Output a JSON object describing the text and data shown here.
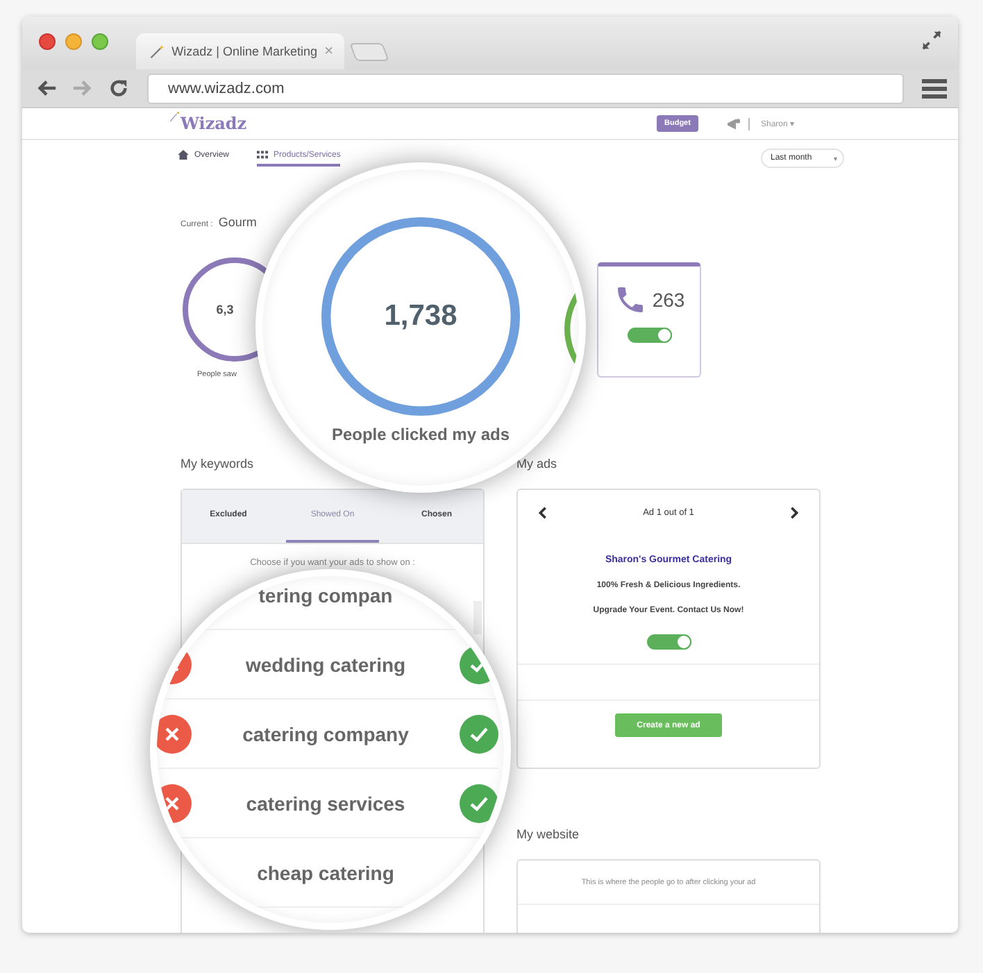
{
  "browser": {
    "tab_title": "Wizadz | Online Marketing",
    "tab_close": "×",
    "url": "www.wizadz.com"
  },
  "header": {
    "logo": "Wizadz",
    "budget_button": "Budget",
    "user": "Sharon",
    "user_caret": "▾"
  },
  "nav": {
    "tabs": [
      {
        "label": "Overview",
        "selected": false
      },
      {
        "label": "Products/Services",
        "selected": true
      }
    ],
    "period": "Last month",
    "period_caret": "▾"
  },
  "current": {
    "label": "Current :",
    "value": "Gourm"
  },
  "stats": [
    {
      "kind": "ring",
      "value": "6,3",
      "label": "People saw"
    },
    {
      "kind": "phone",
      "value": "263",
      "on": true
    }
  ],
  "magnified_stat": {
    "value": "1,738",
    "label": "People clicked my ads"
  },
  "keywords": {
    "heading": "My keywords",
    "tabs": [
      {
        "label": "Excluded",
        "selected": false
      },
      {
        "label": "Showed On",
        "selected": true
      },
      {
        "label": "Chosen",
        "selected": false
      }
    ],
    "hint": "Choose if you want your ads to show on :",
    "top_cut_row": "tering compan",
    "rows": [
      {
        "text": "wedding catering"
      },
      {
        "text": "catering company"
      },
      {
        "text": "catering services"
      }
    ],
    "bottom_row": "cheap catering"
  },
  "ads": {
    "heading": "My ads",
    "pager": "Ad 1 out of 1",
    "title": "Sharon's Gourmet Catering",
    "lines": [
      "100% Fresh & Delicious Ingredients.",
      "Upgrade Your Event. Contact Us Now!"
    ],
    "on": true,
    "button": "Create a new ad"
  },
  "website": {
    "heading": "My website",
    "hint": "This is where the people go to after clicking your ad"
  }
}
